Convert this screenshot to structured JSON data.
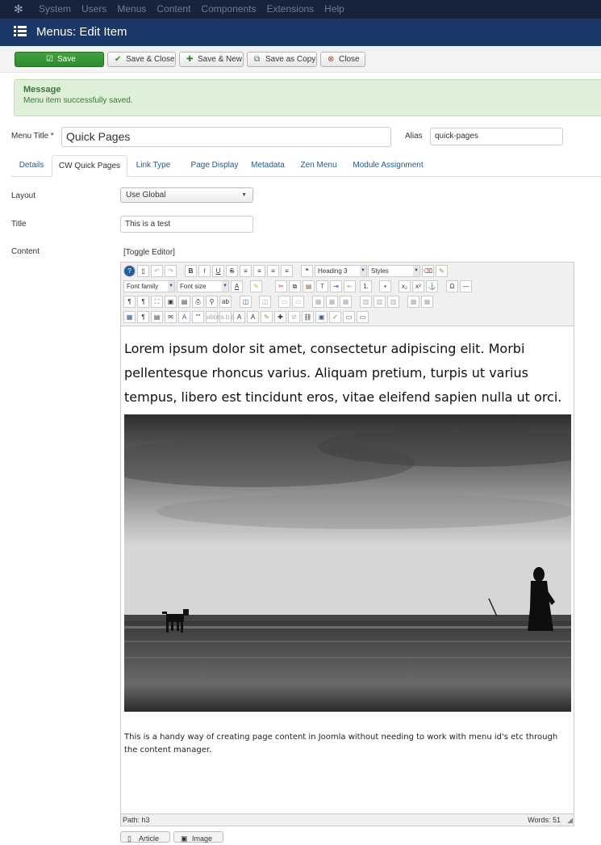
{
  "topbar": {
    "menu": [
      "System",
      "Users",
      "Menus",
      "Content",
      "Components",
      "Extensions",
      "Help"
    ]
  },
  "header": {
    "title": "Menus: Edit Item"
  },
  "toolbar": {
    "save": "Save",
    "save_close": "Save & Close",
    "save_new": "Save & New",
    "save_copy": "Save as Copy",
    "close": "Close"
  },
  "message": {
    "heading": "Message",
    "body": "Menu item successfully saved."
  },
  "form": {
    "menu_title_label": "Menu Title *",
    "menu_title_value": "Quick Pages",
    "alias_label": "Alias",
    "alias_value": "quick-pages"
  },
  "tabs": [
    "Details",
    "CW Quick Pages",
    "Link Type",
    "Page Display",
    "Metadata",
    "Zen Menu",
    "Module Assignment"
  ],
  "fields": {
    "layout_label": "Layout",
    "layout_value": "Use Global",
    "title_label": "Title",
    "title_value": "This is a test",
    "content_label": "Content",
    "toggle_editor": "[Toggle Editor]"
  },
  "editor": {
    "heading_select": "Heading 3",
    "styles_select": "Styles",
    "font_family_select": "Font family",
    "font_size_select": "Font size",
    "lorem": "Lorem ipsum dolor sit amet, consectetur adipiscing elit. Morbi pellentesque rhoncus varius. Aliquam pretium, turpis ut varius tempus, libero est tincidunt eros, vitae eleifend sapien nulla ut orci.",
    "caption": "This is a handy way of creating page content in Joomla without needing to work with menu id's etc through the content manager.",
    "path": "Path:  h3",
    "words": "Words: 51"
  },
  "bottom_buttons": {
    "article": "Article",
    "image": "Image"
  },
  "colors": {
    "topbar": "#17233a",
    "header": "#1a3867",
    "save_green": "#2d8a2d",
    "message_bg": "#dff0d8",
    "link_blue": "#1f5a9c"
  }
}
